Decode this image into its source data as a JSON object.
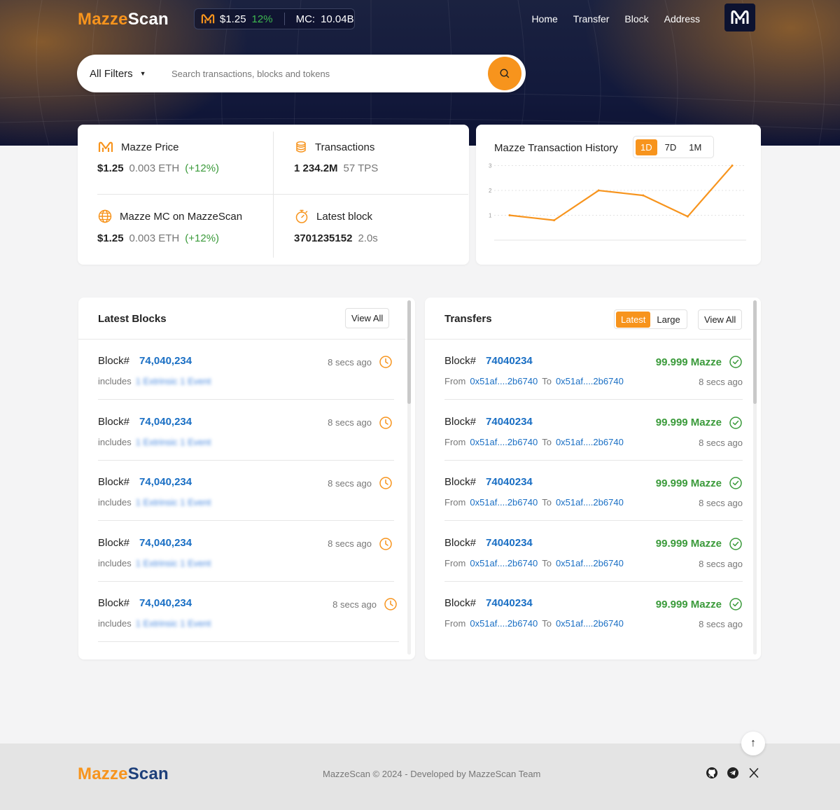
{
  "brand": {
    "part1": "Mazze",
    "part2": "Scan"
  },
  "ticker": {
    "price": "$1.25",
    "change": "12%",
    "mc_label": "MC:",
    "mc_value": "10.04B"
  },
  "nav": {
    "items": [
      "Home",
      "Transfer",
      "Block",
      "Address"
    ]
  },
  "search": {
    "filter_label": "All Filters",
    "placeholder": "Search transactions, blocks and tokens"
  },
  "stats": {
    "price": {
      "label": "Mazze Price",
      "value": "$1.25",
      "eth": "0.003 ETH",
      "change": "(+12%)"
    },
    "transactions": {
      "label": "Transactions",
      "value": "1 234.2M",
      "tps": "57 TPS"
    },
    "mc": {
      "label": "Mazze MC on MazzeScan",
      "value": "$1.25",
      "eth": "0.003 ETH",
      "change": "(+12%)"
    },
    "latest_block": {
      "label": "Latest block",
      "value": "3701235152",
      "time": "2.0s"
    }
  },
  "chart_data": {
    "type": "line",
    "title": "Mazze Transaction History",
    "ranges": [
      "1D",
      "7D",
      "1M"
    ],
    "active_range": "1D",
    "x": [
      1,
      2,
      3,
      4,
      5,
      6
    ],
    "values": [
      1.0,
      0.8,
      2.0,
      1.8,
      0.95,
      3.0
    ],
    "yticks": [
      "1",
      "2",
      "3"
    ],
    "ylim": [
      0,
      3.1
    ],
    "grid": true,
    "color": "#f7941d"
  },
  "blocks": {
    "title": "Latest Blocks",
    "view_all": "View All",
    "rows": [
      {
        "label": "Block#",
        "number": "74,040,234",
        "time": "8 secs ago",
        "includes": "includes",
        "detail": "1 Extrinsic 1 Event"
      },
      {
        "label": "Block#",
        "number": "74,040,234",
        "time": "8 secs ago",
        "includes": "includes",
        "detail": "1 Extrinsic 1 Event"
      },
      {
        "label": "Block#",
        "number": "74,040,234",
        "time": "8 secs ago",
        "includes": "includes",
        "detail": "1 Extrinsic 1 Event"
      },
      {
        "label": "Block#",
        "number": "74,040,234",
        "time": "8 secs ago",
        "includes": "includes",
        "detail": "1 Extrinsic 1 Event"
      },
      {
        "label": "Block#",
        "number": "74,040,234",
        "time": "8 secs ago",
        "includes": "includes",
        "detail": "1 Extrinsic 1 Event"
      }
    ]
  },
  "transfers": {
    "title": "Transfers",
    "tabs": [
      "Latest",
      "Large"
    ],
    "view_all": "View All",
    "rows": [
      {
        "label": "Block#",
        "number": "74040234",
        "amount": "99.999 Mazze",
        "from_label": "From",
        "from": "0x51af....2b6740",
        "to_label": "To",
        "to": "0x51af....2b6740",
        "time": "8 secs ago"
      },
      {
        "label": "Block#",
        "number": "74040234",
        "amount": "99.999 Mazze",
        "from_label": "From",
        "from": "0x51af....2b6740",
        "to_label": "To",
        "to": "0x51af....2b6740",
        "time": "8 secs ago"
      },
      {
        "label": "Block#",
        "number": "74040234",
        "amount": "99.999 Mazze",
        "from_label": "From",
        "from": "0x51af....2b6740",
        "to_label": "To",
        "to": "0x51af....2b6740",
        "time": "8 secs ago"
      },
      {
        "label": "Block#",
        "number": "74040234",
        "amount": "99.999 Mazze",
        "from_label": "From",
        "from": "0x51af....2b6740",
        "to_label": "To",
        "to": "0x51af....2b6740",
        "time": "8 secs ago"
      },
      {
        "label": "Block#",
        "number": "74040234",
        "amount": "99.999 Mazze",
        "from_label": "From",
        "from": "0x51af....2b6740",
        "to_label": "To",
        "to": "0x51af....2b6740",
        "time": "8 secs ago"
      }
    ]
  },
  "footer": {
    "copyright": "MazzeScan © 2024 - Developed by MazzeScan Team",
    "scroll_top": "↑"
  },
  "colors": {
    "accent": "#f7941d",
    "link": "#1a6fc4",
    "positive": "#3a9a3a",
    "navy": "#131a3c"
  }
}
